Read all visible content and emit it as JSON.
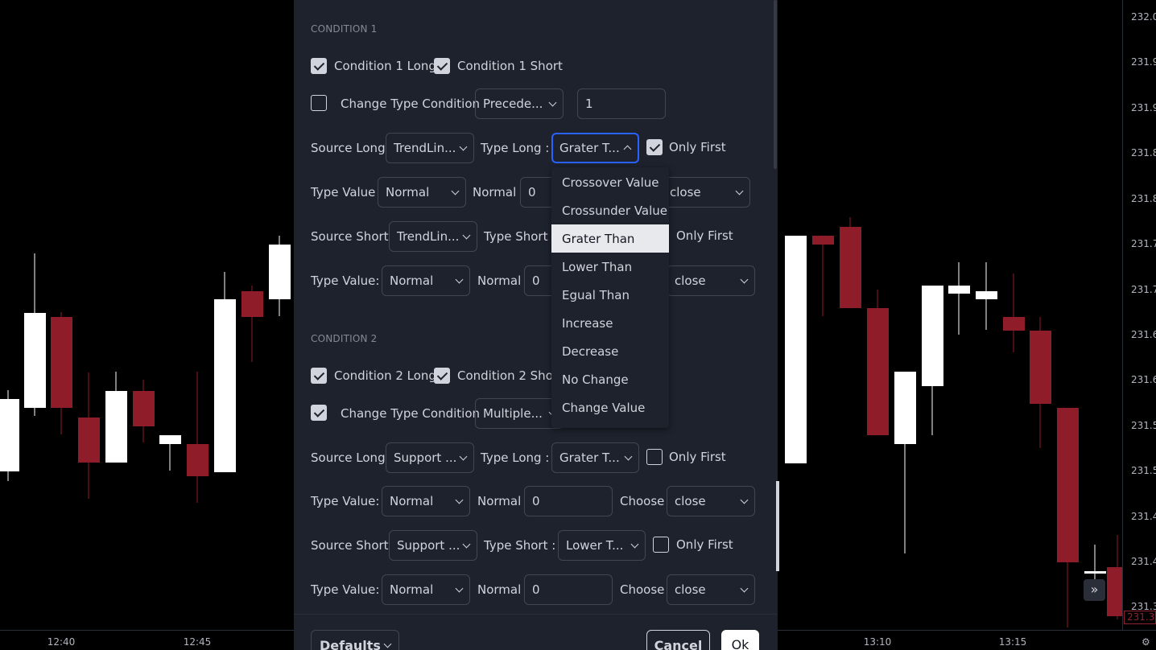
{
  "chart": {
    "price_labels": [
      "232.0",
      "231.9",
      "231.9",
      "231.8",
      "231.8",
      "231.7",
      "231.7",
      "231.6",
      "231.6",
      "231.5",
      "231.5",
      "231.4",
      "231.4",
      "231.3"
    ],
    "time_labels": [
      "12:40",
      "12:45",
      "13:10",
      "13:15"
    ],
    "current_price": "231.3",
    "colors": {
      "up": "#ffffff",
      "down": "#8f1d29",
      "background": "#000000"
    },
    "scroll_icon": "double-chevron-right-icon",
    "corner_icon": "gear-icon"
  },
  "dialog": {
    "condition1": {
      "title": "CONDITION 1",
      "long_label": "Condition 1 Long",
      "long_checked": true,
      "short_label": "Condition 1 Short",
      "short_checked": true,
      "change_type_label": "Change Type Condition",
      "change_type_checked": false,
      "change_type_value": "Precede...",
      "change_type_number": "1",
      "source_long_label": "Source Long",
      "source_long_value": "TrendLin...",
      "type_long_label": "Type Long :",
      "type_long_value": "Grater T...",
      "only_first_long_label": "Only First",
      "only_first_long_checked": true,
      "type_value_label": "Type Value",
      "type_value_value": "Normal",
      "normal_label": "Normal",
      "normal_value": "0",
      "choose_value": "close",
      "source_short_label": "Source Short",
      "source_short_value": "TrendLin...",
      "type_short_label": "Type Short :",
      "only_first_short_label": "Only First",
      "type_value2_label": "Type Value:",
      "type_value2_value": "Normal",
      "normal2_label": "Normal",
      "normal2_value": "0",
      "choose2_value": "close"
    },
    "condition2": {
      "title": "CONDITION 2",
      "long_label": "Condition 2 Long",
      "long_checked": true,
      "short_label": "Condition 2 Short",
      "short_checked": true,
      "change_type_label": "Change Type Condition",
      "change_type_checked": true,
      "change_type_value": "Multiple...",
      "source_long_label": "Source Long",
      "source_long_value": "Support ...",
      "type_long_label": "Type Long :",
      "type_long_value": "Grater T...",
      "only_first_long_label": "Only First",
      "only_first_long_checked": false,
      "type_value_label": "Type Value:",
      "type_value_value": "Normal",
      "normal_label": "Normal",
      "normal_value": "0",
      "choose_label": "Choose",
      "choose_value": "close",
      "source_short_label": "Source Short",
      "source_short_value": "Support ...",
      "type_short_label": "Type Short :",
      "type_short_value": "Lower T...",
      "only_first_short_label": "Only First",
      "only_first_short_checked": false,
      "type_value2_label": "Type Value:",
      "type_value2_value": "Normal",
      "normal2_label": "Normal",
      "normal2_value": "0",
      "choose2_label": "Choose",
      "choose2_value": "close"
    },
    "footer": {
      "defaults_label": "Defaults",
      "cancel_label": "Cancel",
      "ok_label": "Ok"
    }
  },
  "dropdown": {
    "items": [
      "Crossover Value",
      "Crossunder Value",
      "Grater Than",
      "Lower Than",
      "Egual Than",
      "Increase",
      "Decrease",
      "No Change",
      "Change Value"
    ],
    "selected": "Grater Than"
  }
}
